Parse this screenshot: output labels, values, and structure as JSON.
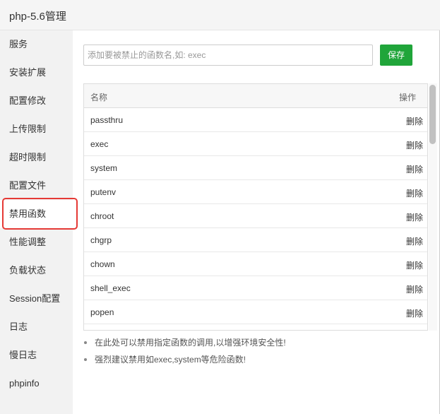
{
  "window": {
    "title": "php-5.6管理"
  },
  "sidebar": {
    "items": [
      {
        "label": "服务"
      },
      {
        "label": "安装扩展"
      },
      {
        "label": "配置修改"
      },
      {
        "label": "上传限制"
      },
      {
        "label": "超时限制"
      },
      {
        "label": "配置文件"
      },
      {
        "label": "禁用函数",
        "active": true
      },
      {
        "label": "性能调整"
      },
      {
        "label": "负载状态"
      },
      {
        "label": "Session配置"
      },
      {
        "label": "日志"
      },
      {
        "label": "慢日志"
      },
      {
        "label": "phpinfo"
      }
    ]
  },
  "form": {
    "placeholder": "添加要被禁止的函数名,如: exec",
    "save_label": "保存"
  },
  "table": {
    "headers": {
      "name": "名称",
      "op": "操作"
    },
    "rows": [
      {
        "name": "passthru",
        "op": "删除"
      },
      {
        "name": "exec",
        "op": "删除"
      },
      {
        "name": "system",
        "op": "删除"
      },
      {
        "name": "putenv",
        "op": "删除"
      },
      {
        "name": "chroot",
        "op": "删除"
      },
      {
        "name": "chgrp",
        "op": "删除"
      },
      {
        "name": "chown",
        "op": "删除"
      },
      {
        "name": "shell_exec",
        "op": "删除"
      },
      {
        "name": "popen",
        "op": "删除"
      }
    ]
  },
  "notes": [
    "在此处可以禁用指定函数的调用,以增强环境安全性!",
    "强烈建议禁用如exec,system等危险函数!"
  ],
  "colors": {
    "accent": "#20a53a",
    "highlight": "#e53935"
  }
}
